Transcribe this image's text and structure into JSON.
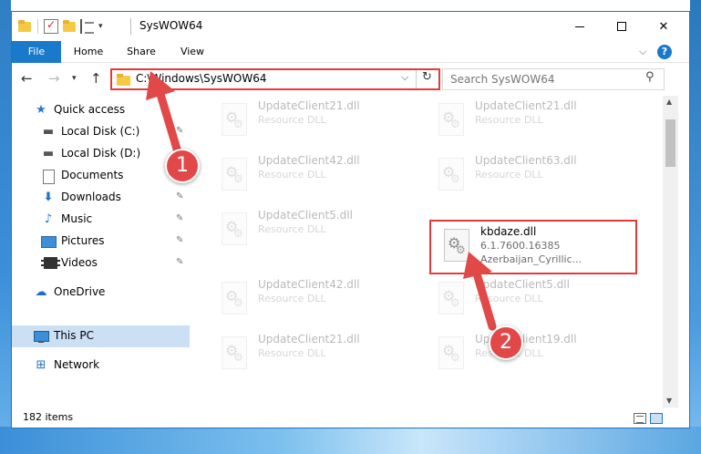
{
  "window": {
    "title": "SysWOW64",
    "minimize_glyph": "",
    "maximize_glyph": "",
    "close_glyph": "✕"
  },
  "ribbon": {
    "tabs": [
      "File",
      "Home",
      "Share",
      "View"
    ],
    "help_glyph": "?"
  },
  "nav": {
    "back_glyph": "←",
    "forward_glyph": "→",
    "recent_glyph": "▾",
    "up_glyph": "↑",
    "address": "C:\\Windows\\SysWOW64",
    "address_dropdown_glyph": "⌵",
    "refresh_glyph": "↻",
    "search_placeholder": "Search SysWOW64",
    "search_icon_glyph": "⚲"
  },
  "sidebar": {
    "items": [
      {
        "label": "Quick access",
        "icon": "star-icon",
        "pinned": false
      },
      {
        "label": "Local Disk (C:)",
        "icon": "disk-icon",
        "pinned": true
      },
      {
        "label": "Local Disk (D:)",
        "icon": "disk-icon",
        "pinned": false
      },
      {
        "label": "Documents",
        "icon": "documents-icon",
        "pinned": true
      },
      {
        "label": "Downloads",
        "icon": "download-icon",
        "pinned": true
      },
      {
        "label": "Music",
        "icon": "music-icon",
        "pinned": true
      },
      {
        "label": "Pictures",
        "icon": "pictures-icon",
        "pinned": true
      },
      {
        "label": "Videos",
        "icon": "videos-icon",
        "pinned": true
      },
      {
        "label": "OneDrive",
        "icon": "cloud-icon",
        "pinned": false
      },
      {
        "label": "This PC",
        "icon": "computer-icon",
        "pinned": false,
        "selected": true
      },
      {
        "label": "Network",
        "icon": "network-icon",
        "pinned": false
      }
    ],
    "pin_glyph": "📌"
  },
  "files": [
    {
      "name": "UpdateClient21.dll",
      "line2": "Resource DLL",
      "line3": ""
    },
    {
      "name": "UpdateClient21.dll",
      "line2": "Resource DLL",
      "line3": ""
    },
    {
      "name": "UpdateClient42.dll",
      "line2": "Resource DLL",
      "line3": ""
    },
    {
      "name": "UpdateClient63.dll",
      "line2": "Resource DLL",
      "line3": ""
    },
    {
      "name": "UpdateClient5.dll",
      "line2": "Resource DLL",
      "line3": ""
    },
    {
      "name": "kbdaze.dll",
      "line2": "6.1.7600.16385",
      "line3": "Azerbaijan_Cyrillic...",
      "highlighted": true
    },
    {
      "name": "UpdateClient42.dll",
      "line2": "Resource DLL",
      "line3": ""
    },
    {
      "name": "UpdateClient5.dll",
      "line2": "Resource DLL",
      "line3": ""
    },
    {
      "name": "UpdateClient21.dll",
      "line2": "Resource DLL",
      "line3": ""
    },
    {
      "name": "UpdateClient19.dll",
      "line2": "Resource DLL",
      "line3": ""
    }
  ],
  "status": {
    "item_count": "182 items"
  },
  "annotations": {
    "step1": "1",
    "step2": "2",
    "color": "#e24848"
  }
}
